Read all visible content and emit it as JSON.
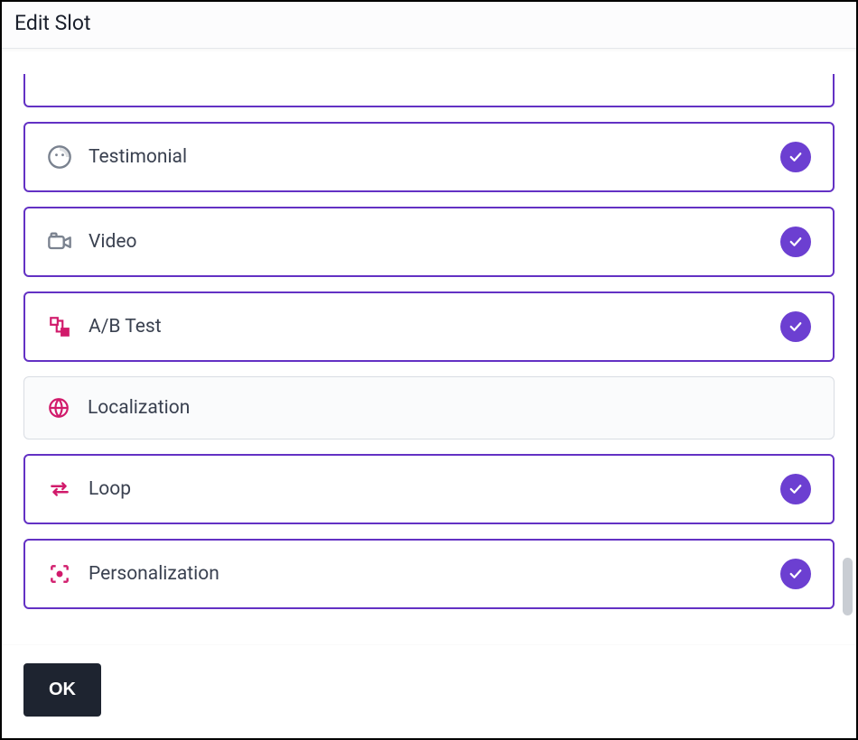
{
  "dialog": {
    "title": "Edit Slot",
    "ok_label": "OK"
  },
  "slots": [
    {
      "id": "partial",
      "label": "",
      "icon": "none",
      "selected": true,
      "partialTop": true
    },
    {
      "id": "testimonial",
      "label": "Testimonial",
      "icon": "face",
      "selected": true
    },
    {
      "id": "video",
      "label": "Video",
      "icon": "video",
      "selected": true
    },
    {
      "id": "abtest",
      "label": "A/B Test",
      "icon": "abtest",
      "selected": true
    },
    {
      "id": "localization",
      "label": "Localization",
      "icon": "globe",
      "selected": false
    },
    {
      "id": "loop",
      "label": "Loop",
      "icon": "loop",
      "selected": true
    },
    {
      "id": "personalization",
      "label": "Personalization",
      "icon": "personalization",
      "selected": true
    }
  ],
  "colors": {
    "accent": "#6331c4",
    "check_bg": "#6c3fd1",
    "icon_magenta": "#d11a6b",
    "icon_gray": "#7a828f"
  }
}
